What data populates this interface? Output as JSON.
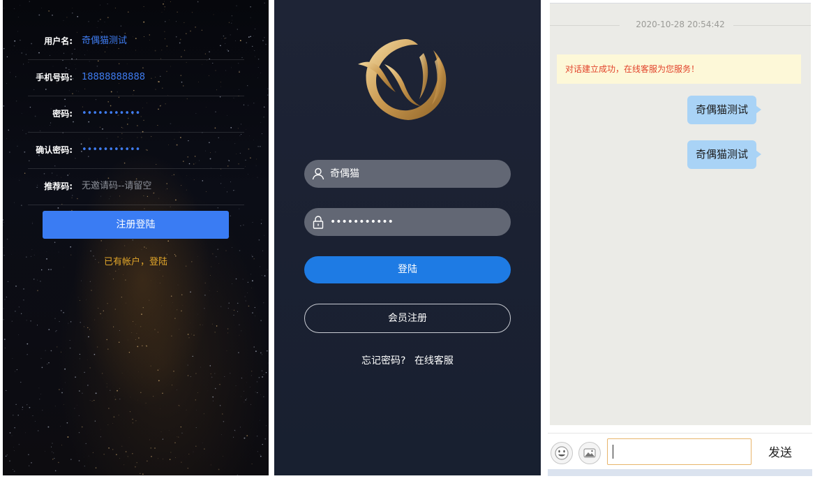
{
  "register": {
    "fields": [
      {
        "label": "用户名:",
        "value": "奇偶猫测试",
        "kind": "text"
      },
      {
        "label": "手机号码:",
        "value": "18888888888",
        "kind": "text"
      },
      {
        "label": "密码:",
        "value": "•••••••••••",
        "kind": "password"
      },
      {
        "label": "确认密码:",
        "value": "•••••••••••",
        "kind": "password"
      },
      {
        "label": "推荐码:",
        "value": "",
        "placeholder": "无邀请码--请留空",
        "kind": "placeholder"
      }
    ],
    "submit_label": "注册登陆",
    "login_link": "已有帐户，登陆"
  },
  "login": {
    "username": "奇偶猫",
    "password": "•••••••••••",
    "login_label": "登陆",
    "register_label": "会员注册",
    "forgot_label": "忘记密码?",
    "service_label": "在线客服",
    "icons": {
      "user": "user-icon",
      "lock": "lock-icon",
      "logo": "phoenix-logo"
    }
  },
  "chat": {
    "timestamp": "2020-10-28 20:54:42",
    "system_message": "对话建立成功，在线客服为您服务！",
    "messages": [
      "奇偶猫测试",
      "奇偶猫测试"
    ],
    "input_value": "",
    "send_label": "发送",
    "icons": {
      "emoji": "emoji-icon",
      "image": "image-icon"
    }
  },
  "colors": {
    "register_button": "#3a7cf3",
    "login_button": "#1e7be4",
    "link_gold": "#e0a52a",
    "bubble": "#a9d3f6",
    "system_text": "#e2432b"
  }
}
